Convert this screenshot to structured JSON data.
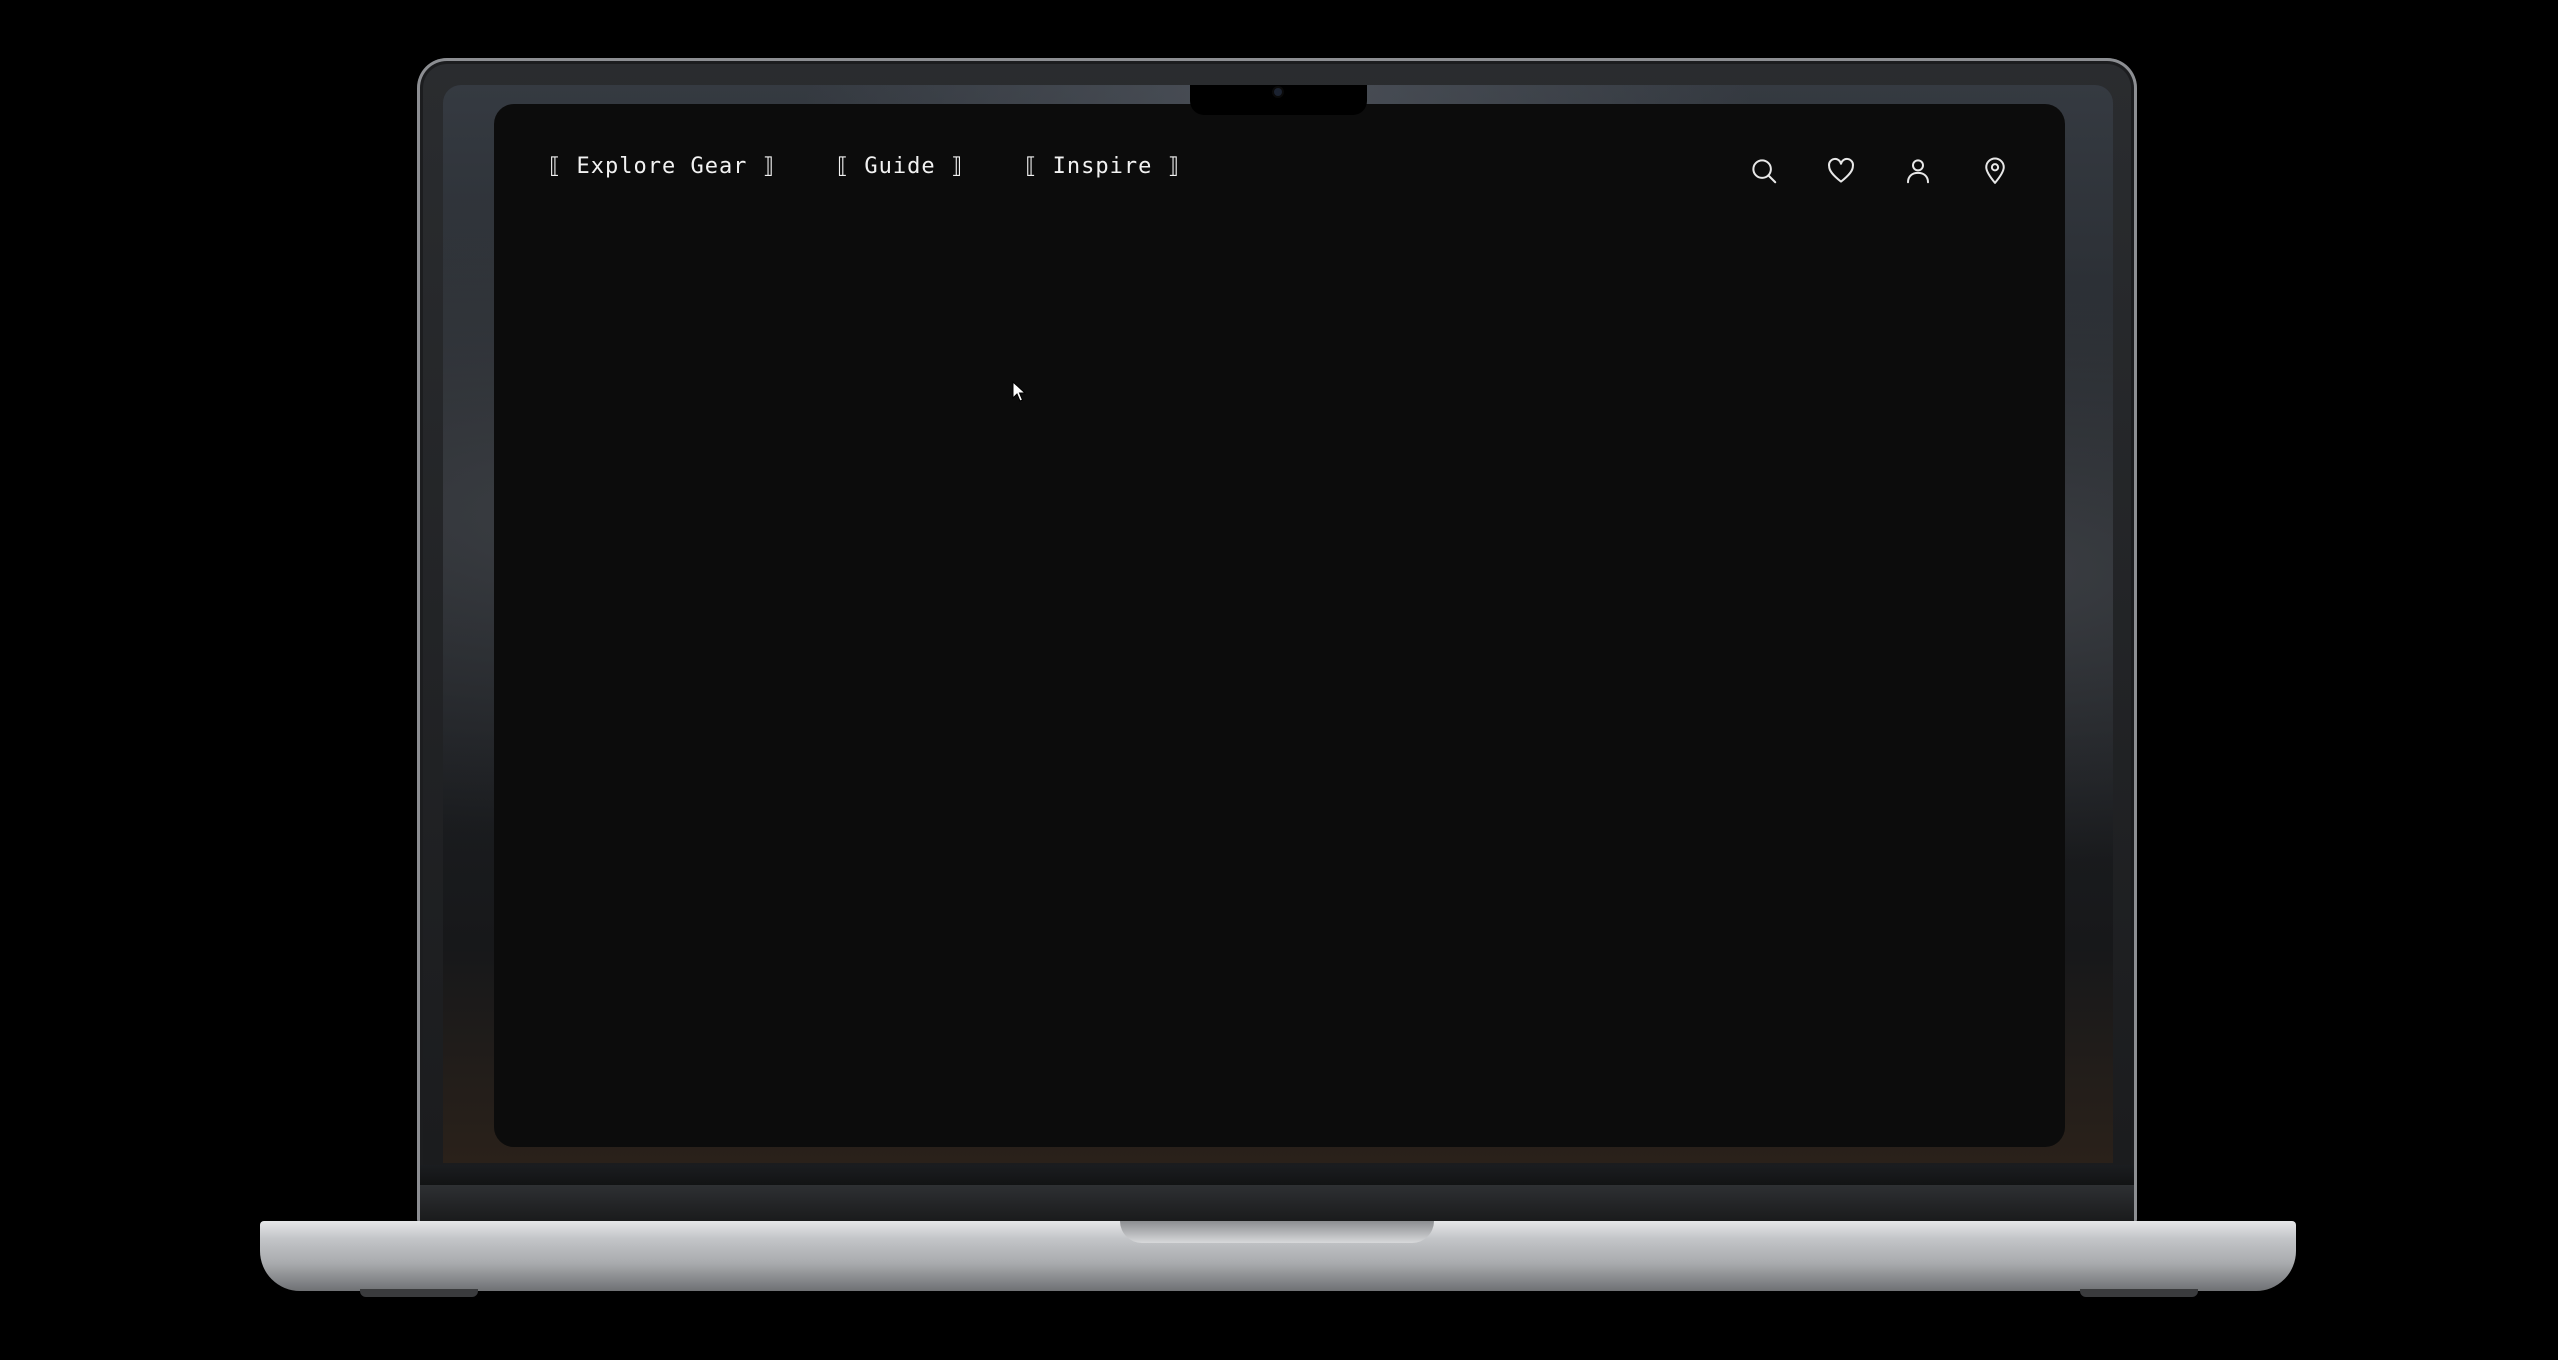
{
  "nav": {
    "items": [
      {
        "label": "⟦ Explore Gear ⟧"
      },
      {
        "label": "⟦ Guide ⟧"
      },
      {
        "label": "⟦ Inspire ⟧"
      }
    ]
  },
  "icons": [
    {
      "name": "search-icon"
    },
    {
      "name": "heart-icon"
    },
    {
      "name": "user-icon"
    },
    {
      "name": "location-pin-icon"
    }
  ],
  "colors": {
    "background": "#000000",
    "app_background": "#0c0c0c",
    "text": "#f2f2f2"
  }
}
